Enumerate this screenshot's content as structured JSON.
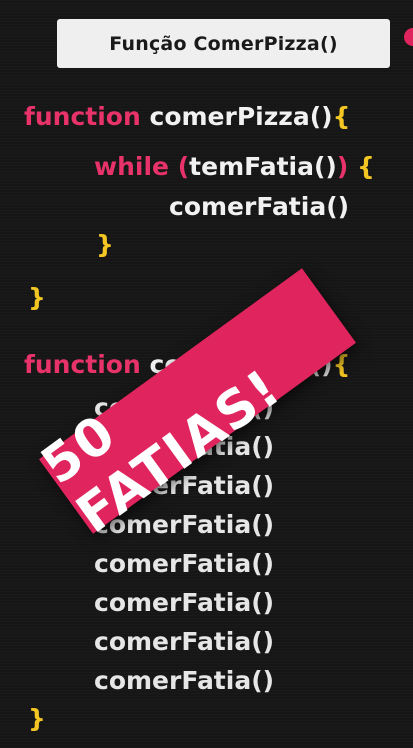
{
  "header": {
    "title": "Função ComerPizza()"
  },
  "code_top": {
    "keyword": "function",
    "fn_name": "comerPizza()",
    "open_brace": "{",
    "while_kw": "while",
    "cond_open": "(",
    "cond_call": "temFatia()",
    "cond_close": ")",
    "while_brace": "{",
    "body_call": "comerFatia()",
    "inner_close": "}",
    "outer_close": "}"
  },
  "code_bottom": {
    "keyword": "function",
    "fn_name": "comerPizza()",
    "open_brace": "{",
    "calls": [
      "comerFatia()",
      "comerFatia()",
      "comerFatia()",
      "comerFatia()",
      "comerFatia()",
      "comerFatia()",
      "comerFatia()",
      "comerFatia()"
    ],
    "close_brace": "}"
  },
  "banner": {
    "text": "50 FATIAS!"
  },
  "colors": {
    "keyword": "#e8336a",
    "brace": "#f3c623",
    "banner": "#e0245e",
    "background": "#161616"
  }
}
